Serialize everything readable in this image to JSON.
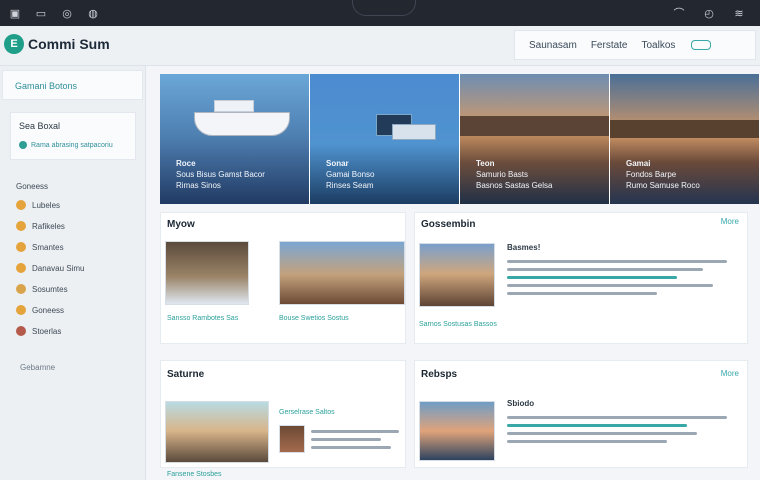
{
  "topbar": {
    "left_icons": [
      "window-icon",
      "folder-icon",
      "refresh-icon",
      "settings-icon"
    ],
    "right_icons": [
      "bookmark-icon",
      "history-icon",
      "menu-icon"
    ]
  },
  "header": {
    "logo_letter": "E",
    "logo_text": "Commi Sum",
    "nav": [
      "Saunasam",
      "Ferstate",
      "Toalkos"
    ]
  },
  "sidebar": {
    "card1_title": "Gamani Botons",
    "card2_title": "Sea Boxal",
    "card2_subtitle": "Rama abrasing satpacoriu",
    "group_title": "Goneess",
    "items": [
      "Lubeles",
      "Rafikeles",
      "Smantes",
      "Danavau  Simu",
      "Sosumtes",
      "Goneess",
      "Stoerlas"
    ],
    "footer": "Gebamne",
    "colors": {
      "accent": "#1f9e89",
      "dot": "#e5a33c"
    }
  },
  "hero": {
    "panels": [
      {
        "title": "Roce",
        "line1": "Sous Bisus Gamst Bacor",
        "line2": "Rimas Sinos"
      },
      {
        "title": "Sonar",
        "line1": "Gamai Bonso",
        "line2": "Rinses Seam"
      },
      {
        "title": "Teon",
        "line1": "Samurio Basts",
        "line2": "Basnos Sastas Gelsa"
      },
      {
        "title": "Gamai",
        "line1": "Fondos Barpe",
        "line2": "Rumo Samuse Roco"
      }
    ]
  },
  "sections": {
    "myown": {
      "title": "Myow",
      "caption1": "Sansso Rambotes Sas",
      "caption2": "Bouse Swetios Sostus"
    },
    "composition": {
      "title": "Gossembin",
      "more": "More",
      "headline": "Basmes!",
      "caption": "Sarnos Sostusas Bassos"
    },
    "saturna": {
      "title": "Saturne",
      "card_headline": "Gerselrase Saltos",
      "caption": "Fansene Stosbes"
    },
    "relays": {
      "title": "Rebsps",
      "more": "More",
      "headline": "Sbiodo"
    }
  }
}
